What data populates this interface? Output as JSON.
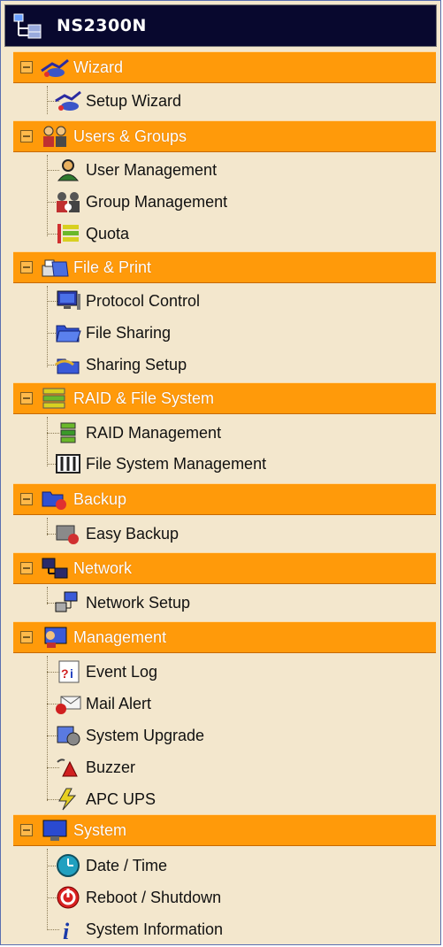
{
  "window": {
    "title": "NS2300N",
    "icon": "server-tree-icon"
  },
  "sections": [
    {
      "label": "Wizard",
      "icon": "wizard-icon",
      "items": [
        {
          "label": "Setup Wizard",
          "icon": "setup-wizard-icon"
        }
      ]
    },
    {
      "label": "Users & Groups",
      "icon": "users-groups-icon",
      "items": [
        {
          "label": "User Management",
          "icon": "user-icon"
        },
        {
          "label": "Group Management",
          "icon": "group-icon"
        },
        {
          "label": "Quota",
          "icon": "quota-icon"
        }
      ]
    },
    {
      "label": "File & Print",
      "icon": "file-print-icon",
      "items": [
        {
          "label": "Protocol Control",
          "icon": "monitor-icon"
        },
        {
          "label": "File Sharing",
          "icon": "folder-icon"
        },
        {
          "label": "Sharing Setup",
          "icon": "sharing-setup-icon"
        }
      ]
    },
    {
      "label": "RAID & File System",
      "icon": "raid-icon",
      "items": [
        {
          "label": "RAID Management",
          "icon": "raid-management-icon"
        },
        {
          "label": "File System Management",
          "icon": "file-system-icon"
        }
      ]
    },
    {
      "label": "Backup",
      "icon": "backup-icon",
      "items": [
        {
          "label": "Easy Backup",
          "icon": "easy-backup-icon"
        }
      ]
    },
    {
      "label": "Network",
      "icon": "network-icon",
      "items": [
        {
          "label": "Network Setup",
          "icon": "network-setup-icon"
        }
      ]
    },
    {
      "label": "Management",
      "icon": "management-icon",
      "items": [
        {
          "label": "Event Log",
          "icon": "event-log-icon"
        },
        {
          "label": "Mail Alert",
          "icon": "mail-alert-icon"
        },
        {
          "label": "System Upgrade",
          "icon": "system-upgrade-icon"
        },
        {
          "label": "Buzzer",
          "icon": "buzzer-icon"
        },
        {
          "label": "APC UPS",
          "icon": "ups-icon"
        }
      ]
    },
    {
      "label": "System",
      "icon": "system-icon",
      "items": [
        {
          "label": "Date / Time",
          "icon": "clock-icon"
        },
        {
          "label": "Reboot / Shutdown",
          "icon": "power-icon"
        },
        {
          "label": "System Information",
          "icon": "info-icon"
        }
      ]
    }
  ],
  "colors": {
    "section_bg": "#ff9a0a",
    "panel_bg": "#f3e7cd",
    "title_bg": "#08082e"
  }
}
